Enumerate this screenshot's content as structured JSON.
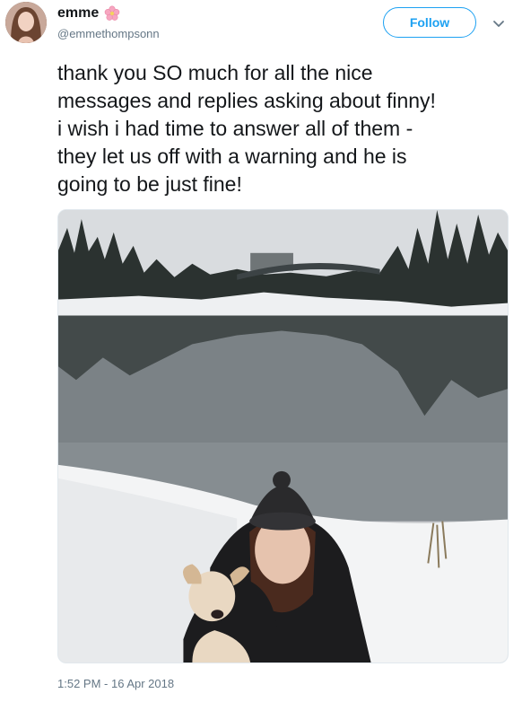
{
  "user": {
    "display_name": "emme",
    "handle": "@emmethompsonn",
    "name_emoji_icon": "cherry-blossom-icon"
  },
  "actions": {
    "follow_label": "Follow",
    "more_icon": "chevron-down-icon"
  },
  "tweet": {
    "text": "thank you SO much for all the nice\nmessages and replies asking about finny!\ni wish i had time to answer all of them -\nthey let us off with a warning and he is\ngoing to be just fine!",
    "timestamp": "1:52 PM - 16 Apr 2018"
  },
  "colors": {
    "accent": "#1da1f2",
    "secondary_text": "#657786"
  }
}
